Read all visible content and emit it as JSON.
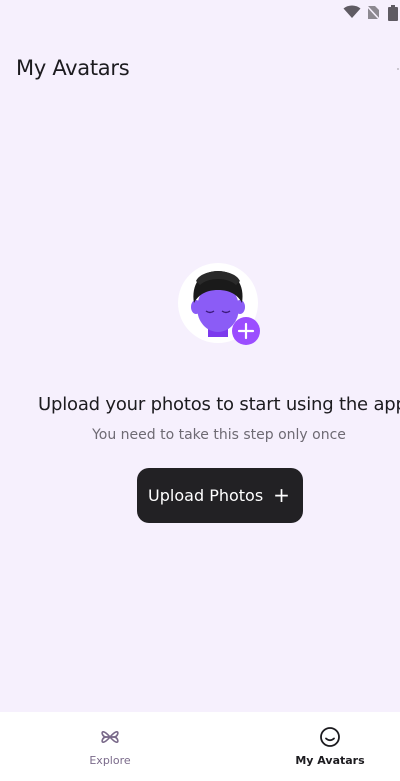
{
  "page": {
    "title": "My Avatars"
  },
  "status_bar": {
    "icons": [
      "wifi-icon",
      "no-sim-icon",
      "battery-icon"
    ]
  },
  "empty_state": {
    "illustration": "avatar-plus-illustration",
    "heading": "Upload your photos to start using the app",
    "subtext": "You need to take this step only once",
    "button_label": "Upload Photos",
    "button_icon": "plus-icon",
    "accent_color": "#9b4dff"
  },
  "bottom_nav": {
    "items": [
      {
        "label": "Explore",
        "icon": "explore-icon",
        "active": false
      },
      {
        "label": "My Avatars",
        "icon": "smiley-icon",
        "active": true
      }
    ]
  },
  "colors": {
    "background": "#f6f0fd",
    "button": "#222124",
    "text": "#1c1b1f",
    "subtext": "#6e6a73",
    "accent": "#9b4dff"
  }
}
